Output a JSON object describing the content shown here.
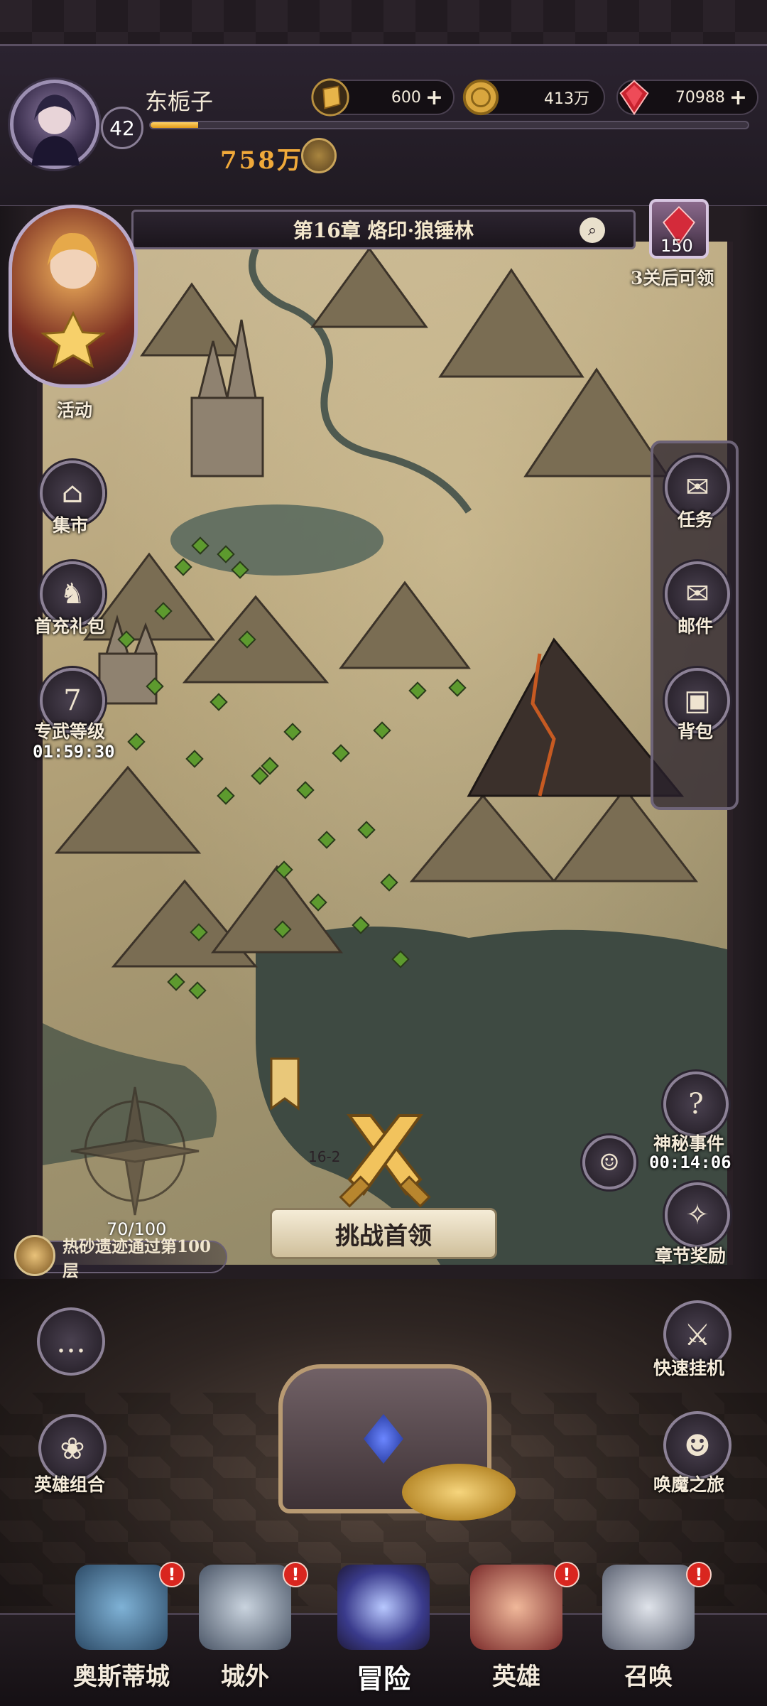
{
  "player": {
    "name": "东栀子",
    "level": "42",
    "xp_fraction": 0.08,
    "power": "758万"
  },
  "currencies": [
    {
      "id": "gold-bar",
      "value": "600",
      "plus": "+"
    },
    {
      "id": "coin",
      "value": "413万",
      "plus": ""
    },
    {
      "id": "gem",
      "value": "70988",
      "plus": "+"
    }
  ],
  "chapter": {
    "title": "第16章 烙印·狼锤林",
    "current_stage": "16-2"
  },
  "reward_preview": {
    "count": "150",
    "label": "3关后可领"
  },
  "left_menu": {
    "event": "活动",
    "market": "集市",
    "first_pack": "首充礼包",
    "weapon_level": "专武等级",
    "weapon_timer": "01:59:30"
  },
  "right_menu": {
    "quest": "任务",
    "mail": "邮件",
    "bag": "背包"
  },
  "right_lower": {
    "mystery": "神秘事件",
    "mystery_timer": "00:14:06",
    "chapter_reward": "章节奖励",
    "quick_idle": "快速挂机",
    "summon_journey": "唤魔之旅"
  },
  "trial": {
    "progress": "70/100",
    "text": "热砂遗迹通过第100层"
  },
  "challenge": {
    "label": "挑战首领"
  },
  "room": {
    "hero_combo": "英雄组合"
  },
  "nav": {
    "city": "奥斯蒂城",
    "outside": "城外",
    "adventure": "冒险",
    "heroes": "英雄",
    "summon": "召唤",
    "alert": "!"
  },
  "colors": {
    "accent_gold": "#f0a93a",
    "alert_red": "#d9261f",
    "path_green": "#5d9a2e"
  }
}
